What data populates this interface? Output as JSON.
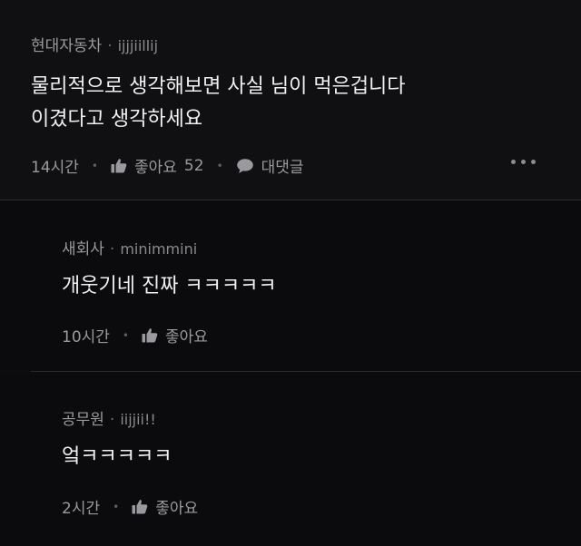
{
  "post": {
    "company": "현대자동차",
    "username": "ijjjiillij",
    "lines": [
      "물리적으로 생각해보면 사실 님이 먹은겁니다",
      "이겼다고 생각하세요"
    ],
    "time": "14시간",
    "like_label": "좋아요",
    "like_count": "52",
    "reply_label": "대댓글",
    "more_icon": "more-horizontal-icon"
  },
  "replies": [
    {
      "company": "새회사",
      "username": "minimmini",
      "text": "개웃기네 진짜 ㅋㅋㅋㅋㅋ",
      "time": "10시간",
      "like_label": "좋아요"
    },
    {
      "company": "공무원",
      "username": "iijjii!!",
      "text": "엌ㅋㅋㅋㅋㅋ",
      "time": "2시간",
      "like_label": "좋아요"
    }
  ],
  "separator": "·",
  "meta_separator": "•",
  "colors": {
    "background": "#0c0c0e",
    "text_primary": "#f1f1f1",
    "text_secondary": "#9a9a9e",
    "divider": "#2a2a2d"
  }
}
